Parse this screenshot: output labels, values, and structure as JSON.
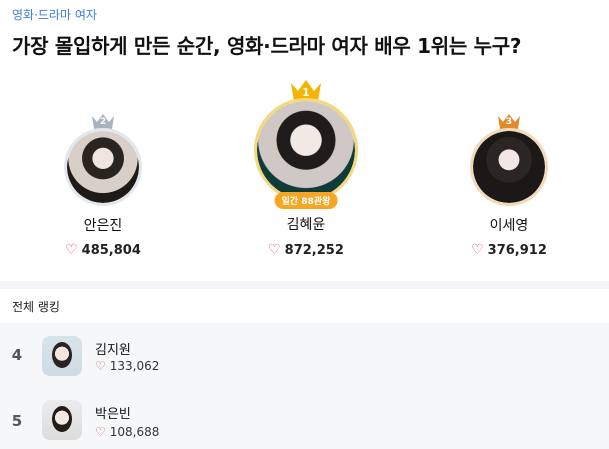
{
  "category": "영화·드라마 여자",
  "headline": "가장 몰입하게 만든 순간, 영화·드라마 여자 배우 1위는 누구?",
  "heart_icon": "heart-outline-icon",
  "colors": {
    "accent": "#3f7de0",
    "gold": "#f5b400",
    "silver": "#a9b3bf",
    "bronze": "#e08a2a",
    "heart": "#e24d5b",
    "badge": "#f5a623"
  },
  "top3": [
    {
      "rank": "1",
      "name": "김혜윤",
      "votes": "872,252",
      "badge": "일간 88관왕"
    },
    {
      "rank": "2",
      "name": "안은진",
      "votes": "485,804"
    },
    {
      "rank": "3",
      "name": "이세영",
      "votes": "376,912"
    }
  ],
  "ranking_title": "전체 랭킹",
  "ranking": [
    {
      "rank": "4",
      "name": "김지원",
      "votes": "133,062"
    },
    {
      "rank": "5",
      "name": "박은빈",
      "votes": "108,688"
    }
  ]
}
